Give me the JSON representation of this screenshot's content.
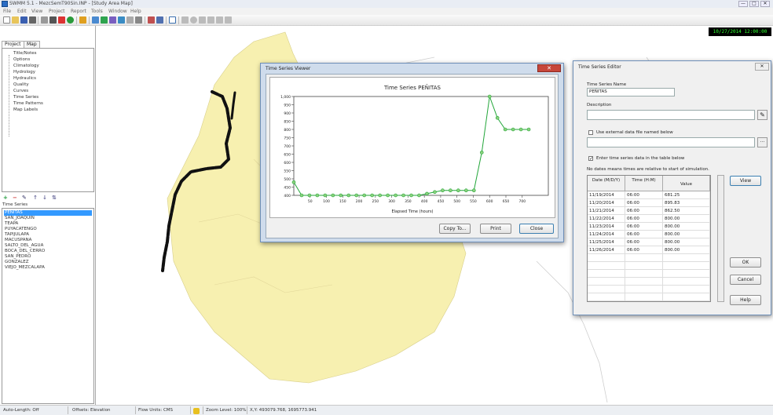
{
  "app": {
    "title": "SWMM 5.1 - MezcSemT90Sin.INP - [Study Area Map]",
    "window_buttons": [
      "—",
      "□",
      "✕"
    ]
  },
  "menu": [
    "File",
    "Edit",
    "View",
    "Project",
    "Report",
    "Tools",
    "Window",
    "Help"
  ],
  "clock": "10/27/2014 12:00:00",
  "left_panel": {
    "tabs": [
      "Project",
      "Map"
    ],
    "tree_items": [
      "Title/Notes",
      "Options",
      "Climatology",
      "Hydrology",
      "Hydraulics",
      "Quality",
      "Curves",
      "Time Series",
      "Time Patterns",
      "Map Labels"
    ],
    "object_toolbar": [
      "+",
      "−",
      "✎",
      "↑",
      "↓",
      "⇅"
    ],
    "object_type": "Time Series",
    "objects": [
      "PEÑITAS",
      "SAN_JOAQUIN",
      "TEAPA",
      "PUYACATENGO",
      "TAPIJULAPA",
      "MACUSPANA",
      "SALTO_DEL_AGUA",
      "BOCA_DEL_CERRO",
      "SAN_PEDRO",
      "GONZALEZ",
      "VIEJO_MEZCALAPA"
    ],
    "selected_index": 0
  },
  "status_bar": {
    "auto_length": "Auto-Length: Off",
    "offsets": "Offsets: Elevation",
    "flow_units": "Flow Units: CMS",
    "zoom": "Zoom Level: 100%",
    "xy": "X,Y: 493079.768, 1695773.941"
  },
  "colors": {
    "accent": "#3399ff",
    "land": "#f7f0b0",
    "river": "#111111",
    "series": "#23a63a",
    "marker": "#8bd17c",
    "clock_text": "#2eff2e"
  },
  "ts_viewer": {
    "title": "Time Series Viewer",
    "buttons": {
      "copy": "Copy To...",
      "print": "Print",
      "close": "Close"
    }
  },
  "chart_data": {
    "type": "line",
    "title": "Time Series PEÑITAS",
    "xlabel": "Elapsed Time (hours)",
    "ylabel": "",
    "xlim": [
      0,
      780
    ],
    "ylim": [
      400,
      1000
    ],
    "x_ticks": [
      50,
      100,
      150,
      200,
      250,
      300,
      350,
      400,
      450,
      500,
      550,
      600,
      650,
      700
    ],
    "y_ticks": [
      400,
      450,
      500,
      550,
      600,
      650,
      700,
      750,
      800,
      850,
      900,
      950,
      1000
    ],
    "grid": false,
    "series": [
      {
        "x": [
          0,
          24,
          48,
          72,
          96,
          120,
          144,
          168,
          192,
          216,
          240,
          264,
          288,
          312,
          336,
          360,
          384,
          408,
          432,
          456,
          480,
          504,
          528,
          552,
          576,
          600,
          624,
          648,
          672,
          696,
          720
        ],
        "y": [
          480,
          400,
          400,
          400,
          400,
          400,
          400,
          400,
          400,
          400,
          400,
          400,
          400,
          400,
          400,
          400,
          400,
          410,
          420,
          430,
          430,
          430,
          430,
          430,
          660,
          1000,
          870,
          800,
          800,
          800,
          800
        ]
      }
    ]
  },
  "ts_editor": {
    "title": "Time Series Editor",
    "name_label": "Time Series Name",
    "name": "PEÑITAS",
    "description_label": "Description",
    "description": "",
    "use_file_label": "Use external data file named below",
    "file_path": "",
    "use_file_checked": false,
    "use_table_label": "Enter time series data in the table below",
    "use_table_checked": true,
    "note": "No dates means times are relative to start of simulation.",
    "columns": [
      "Date (M/D/Y)",
      "Time (H:M)",
      "Value"
    ],
    "rows": [
      [
        "11/19/2014",
        "06:00",
        "681.25"
      ],
      [
        "11/20/2014",
        "06:00",
        "895.83"
      ],
      [
        "11/21/2014",
        "06:00",
        "862.50"
      ],
      [
        "11/22/2014",
        "06:00",
        "800.00"
      ],
      [
        "11/23/2014",
        "06:00",
        "800.00"
      ],
      [
        "11/24/2014",
        "06:00",
        "800.00"
      ],
      [
        "11/25/2014",
        "06:00",
        "800.00"
      ],
      [
        "11/26/2014",
        "06:00",
        "800.00"
      ]
    ],
    "buttons": {
      "view": "View",
      "ok": "OK",
      "cancel": "Cancel",
      "help": "Help"
    }
  }
}
